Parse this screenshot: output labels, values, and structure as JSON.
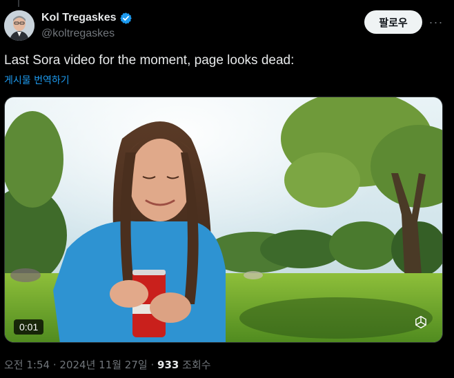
{
  "author": {
    "display_name": "Kol Tregaskes",
    "handle": "@koltregaskes"
  },
  "actions": {
    "follow_label": "팔로우",
    "more_label": "···"
  },
  "tweet": {
    "text": "Last Sora video for the moment, page looks dead:",
    "translate_label": "게시물 번역하기"
  },
  "media": {
    "video_time": "0:01"
  },
  "meta": {
    "time": "오전 1:54",
    "separator": "·",
    "date": "2024년 11월 27일",
    "views_count": "933",
    "views_label": "조회수"
  },
  "colors": {
    "background": "#000000",
    "link": "#1d9bf0",
    "verified": "#1d9bf0",
    "muted": "#71767b"
  }
}
